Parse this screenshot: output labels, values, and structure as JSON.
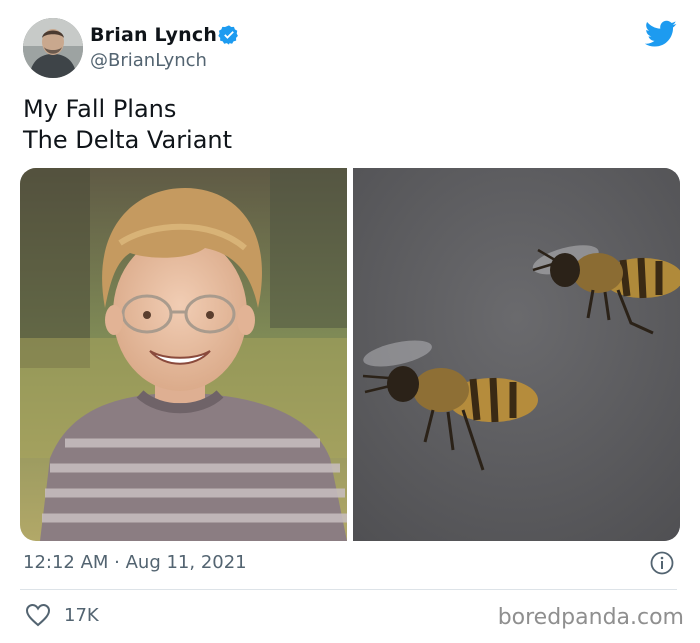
{
  "author": {
    "name": "Brian Lynch",
    "handle": "@BrianLynch",
    "verified": true
  },
  "tweet": {
    "lines": [
      "My Fall Plans",
      "The Delta Variant"
    ],
    "timestamp": "12:12 AM · Aug 11, 2021",
    "likes": "17K"
  },
  "media": [
    {
      "subject": "smiling boy with glasses and striped shirt"
    },
    {
      "subject": "two honeybees flying on grey background"
    }
  ],
  "watermark": "boredpanda.com",
  "colors": {
    "twitter_blue": "#1d9bf0",
    "secondary_text": "#536471",
    "primary_text": "#0f1419"
  },
  "icons": [
    "verified-badge-icon",
    "twitter-bird-icon",
    "info-icon",
    "heart-icon"
  ]
}
